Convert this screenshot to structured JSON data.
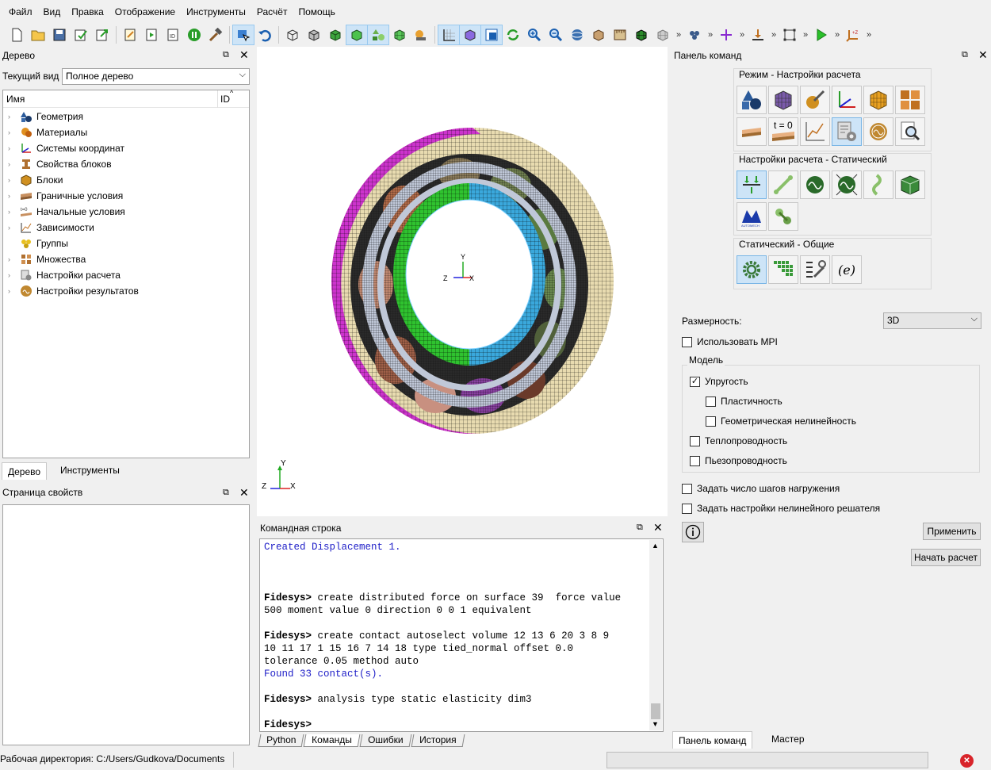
{
  "menu": [
    "Файл",
    "Вид",
    "Правка",
    "Отображение",
    "Инструменты",
    "Расчёт",
    "Помощь"
  ],
  "tree_panel": {
    "title": "Дерево",
    "view_label": "Текущий вид",
    "view_value": "Полное дерево",
    "col_name": "Имя",
    "col_id": "ID",
    "items": [
      {
        "label": "Геометрия",
        "icon": "geometry-icon"
      },
      {
        "label": "Материалы",
        "icon": "materials-icon"
      },
      {
        "label": "Системы координат",
        "icon": "coordinate-systems-icon"
      },
      {
        "label": "Свойства блоков",
        "icon": "block-properties-icon"
      },
      {
        "label": "Блоки",
        "icon": "blocks-icon"
      },
      {
        "label": "Граничные условия",
        "icon": "boundary-conditions-icon"
      },
      {
        "label": "Начальные условия",
        "icon": "initial-conditions-icon"
      },
      {
        "label": "Зависимости",
        "icon": "dependencies-icon"
      },
      {
        "label": "Группы",
        "icon": "groups-icon"
      },
      {
        "label": "Множества",
        "icon": "sets-icon"
      },
      {
        "label": "Настройки расчета",
        "icon": "analysis-settings-icon"
      },
      {
        "label": "Настройки результатов",
        "icon": "result-settings-icon"
      }
    ],
    "tabs": [
      "Дерево",
      "Инструменты"
    ]
  },
  "props_panel": {
    "title": "Страница свойств"
  },
  "viewport": {
    "axis_x": "X",
    "axis_y": "Y",
    "axis_z": "Z"
  },
  "command_line": {
    "title": "Командная строка",
    "lines": [
      {
        "text": "Created Displacement 1.",
        "cls": "blue"
      },
      {
        "text": "",
        "cls": ""
      },
      {
        "text": "",
        "cls": ""
      },
      {
        "text": "",
        "cls": ""
      },
      {
        "prompt": "Fidesys>",
        "text": " create distributed force on surface 39  force value",
        "cls": ""
      },
      {
        "text": "500 moment value 0 direction 0 0 1 equivalent",
        "cls": ""
      },
      {
        "text": "",
        "cls": ""
      },
      {
        "prompt": "Fidesys>",
        "text": " create contact autoselect volume 12 13 6 20 3 8 9",
        "cls": ""
      },
      {
        "text": "10 11 17 1 15 16 7 14 18 type tied_normal offset 0.0",
        "cls": ""
      },
      {
        "text": "tolerance 0.05 method auto",
        "cls": ""
      },
      {
        "text": "Found 33 contact(s).",
        "cls": "blue"
      },
      {
        "text": "",
        "cls": ""
      },
      {
        "prompt": "Fidesys>",
        "text": " analysis type static elasticity dim3",
        "cls": ""
      },
      {
        "text": "",
        "cls": ""
      },
      {
        "prompt": "Fidesys>",
        "text": "",
        "cls": ""
      }
    ],
    "tabs": [
      "Python",
      "Команды",
      "Ошибки",
      "История"
    ]
  },
  "command_panel": {
    "title": "Панель команд",
    "group1": "Режим - Настройки расчета",
    "group2": "Настройки расчета - Статический",
    "group3": "Статический - Общие",
    "t0_label": "t = 0",
    "e_label": "(e)",
    "dimension_label": "Размерность:",
    "dimension_value": "3D",
    "use_mpi": "Использовать MPI",
    "model_label": "Модель",
    "elasticity": "Упругость",
    "plasticity": "Пластичность",
    "geom_nonlin": "Геометрическая нелинейность",
    "heat": "Теплопроводность",
    "piezo": "Пьезопроводность",
    "load_steps": "Задать число шагов нагружения",
    "nonlin_solver": "Задать настройки нелинейного решателя",
    "apply": "Применить",
    "start": "Начать расчет",
    "tabs": [
      "Панель команд",
      "Мастер"
    ]
  },
  "status": {
    "workdir": "Рабочая директория: C:/Users/Gudkova/Documents"
  }
}
